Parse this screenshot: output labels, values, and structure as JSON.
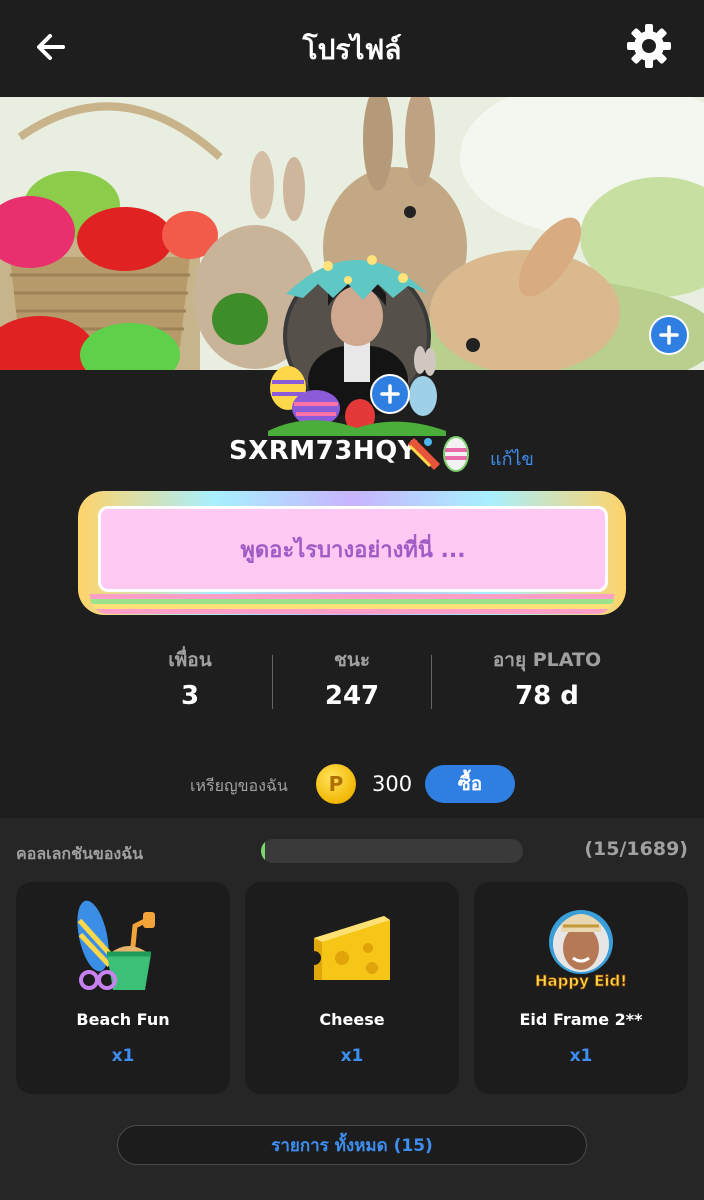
{
  "header": {
    "title": "โปรไฟล์",
    "back_icon": "arrow-left-icon",
    "settings_icon": "gear-icon"
  },
  "profile": {
    "username": "SXRM73HQY",
    "edit_label": "แก้ไข",
    "bio_placeholder": "พูดอะไรบางอย่างที่นี่ ..."
  },
  "stats": [
    {
      "label": "เพื่อน",
      "value": "3"
    },
    {
      "label": "ชนะ",
      "value": "247"
    },
    {
      "label": "อายุ PLATO",
      "value": "78 d"
    }
  ],
  "coins": {
    "label": "เหรียญของฉัน",
    "coin_symbol": "P",
    "value": "300",
    "buy_label": "ซื้อ"
  },
  "collection": {
    "title": "คอลเลกชันของฉัน",
    "count_label": "(15/1689)",
    "progress_fraction": 0.0089,
    "items": [
      {
        "name": "Beach Fun",
        "qty": "x1"
      },
      {
        "name": "Cheese",
        "qty": "x1"
      },
      {
        "name": "Eid Frame 2**",
        "qty": "x1"
      }
    ],
    "all_button_label": "รายการ ทั้งหมด (15)",
    "eid_artwork_text": "Happy Eid!"
  },
  "colors": {
    "accent": "#2f7fe3",
    "link": "#3d8ef0",
    "bio_bg": "#ffc9f4",
    "bio_text": "#a05bc4",
    "coin": "#f2b705"
  }
}
